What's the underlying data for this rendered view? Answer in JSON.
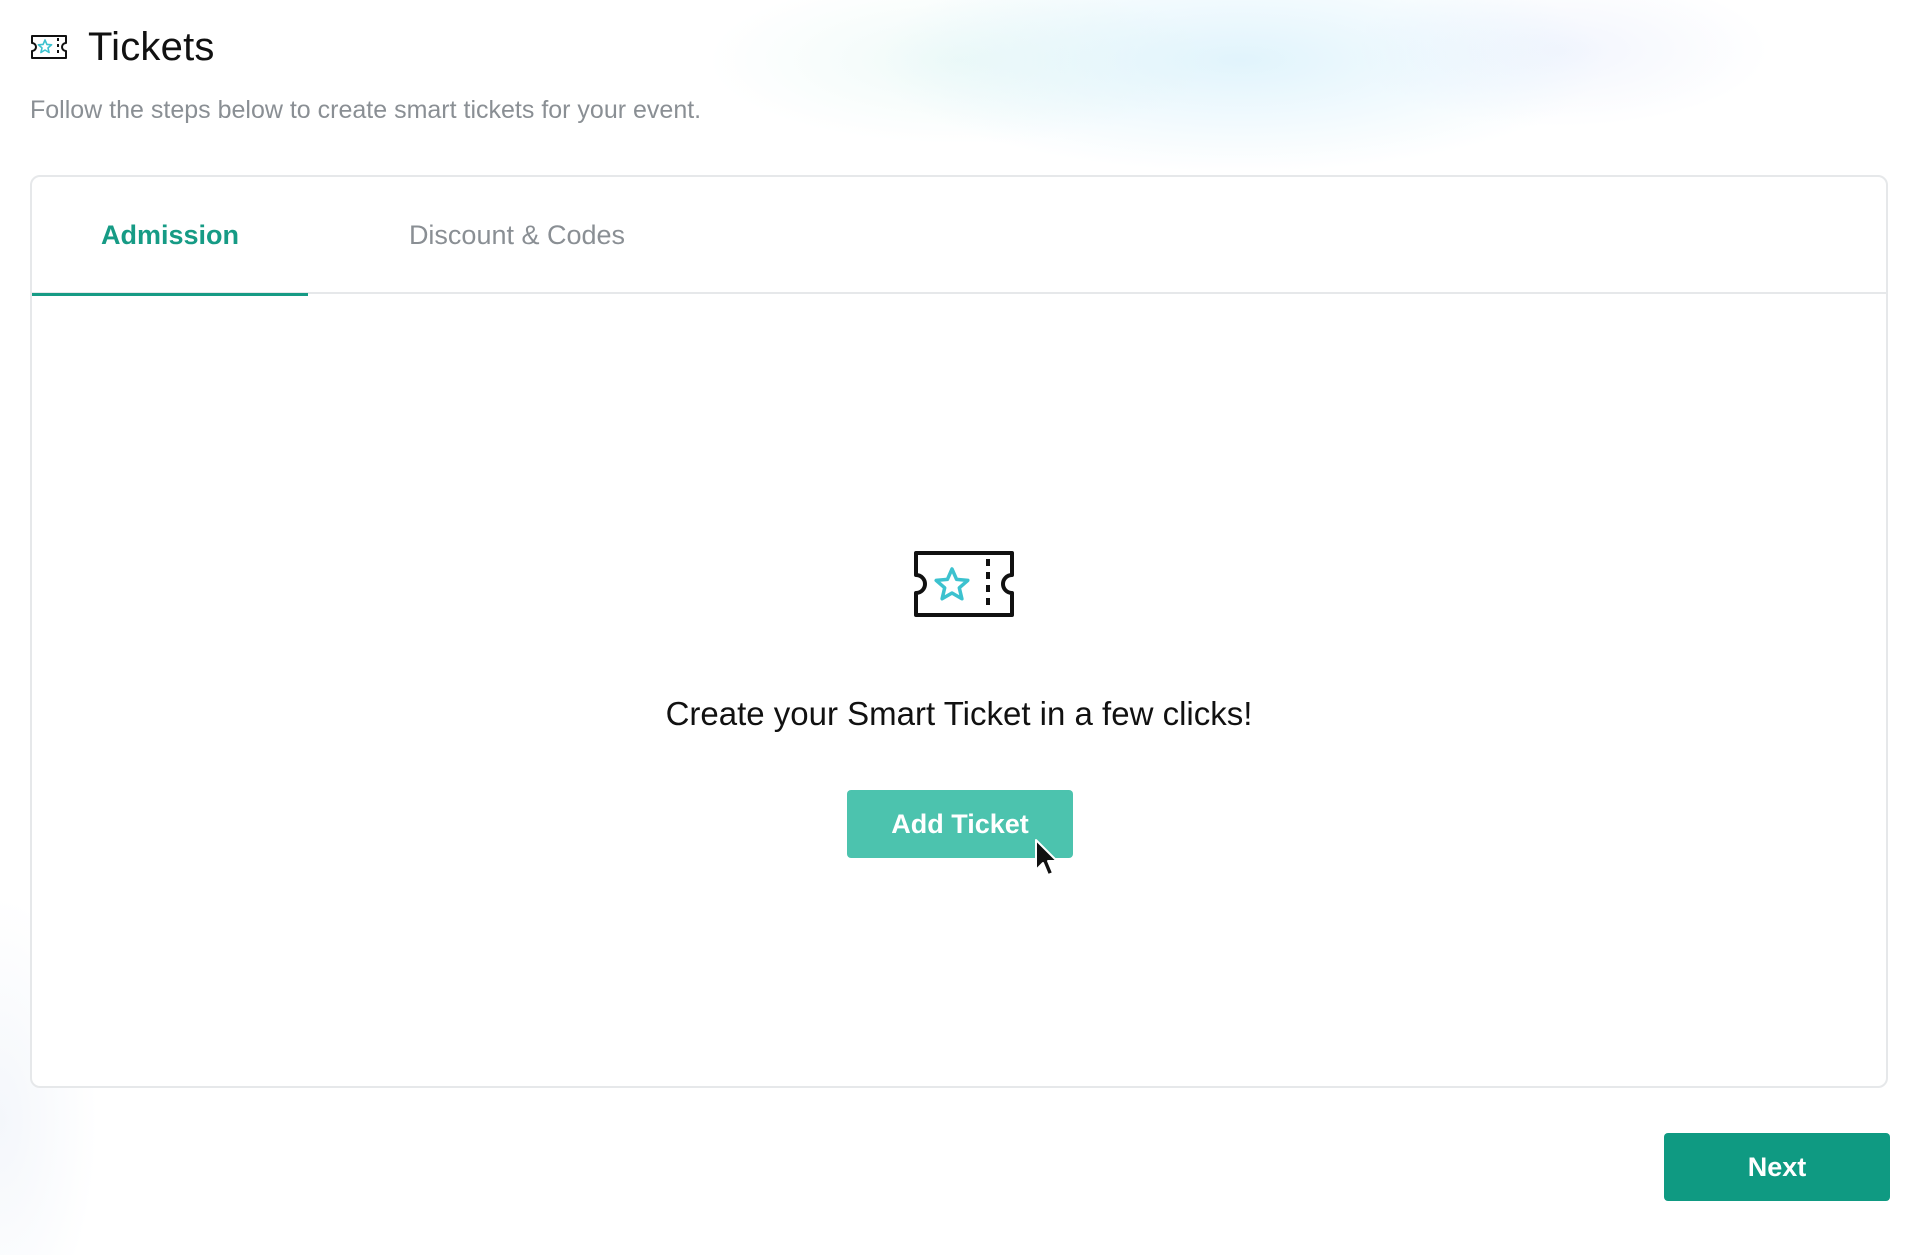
{
  "header": {
    "title": "Tickets",
    "icon": "ticket-star-icon",
    "subtitle": "Follow the steps below to create smart tickets for your event."
  },
  "tabs": [
    {
      "label": "Admission",
      "active": true
    },
    {
      "label": "Discount & Codes",
      "active": false
    }
  ],
  "empty_state": {
    "icon": "ticket-star-icon",
    "message": "Create your Smart Ticket in a few clicks!",
    "button_label": "Add Ticket"
  },
  "footer": {
    "next_label": "Next"
  },
  "colors": {
    "accent": "#169b85",
    "add_button": "#4cc3ae",
    "next_button": "#0f9a82",
    "icon_star": "#3cc2cf",
    "muted_text": "#8a8f94",
    "border": "#e6e8ea"
  }
}
